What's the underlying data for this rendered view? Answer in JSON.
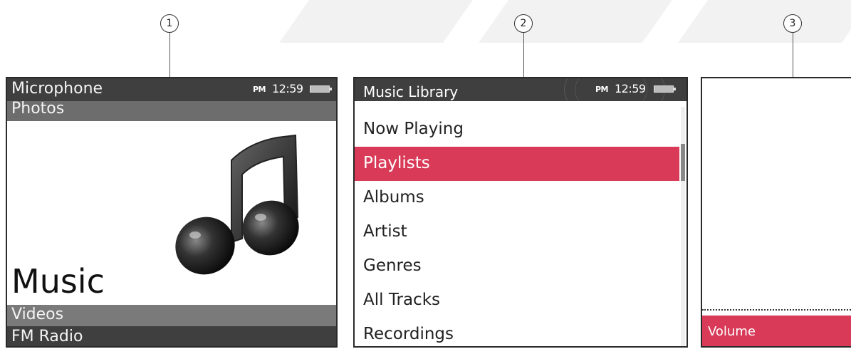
{
  "callouts": [
    "1",
    "2",
    "3"
  ],
  "status": {
    "ampm": "PM",
    "time": "12:59"
  },
  "screen1": {
    "items": [
      "Microphone",
      "Photos",
      "Music",
      "Videos",
      "FM Radio"
    ],
    "icon": "music-note-icon"
  },
  "screen2": {
    "title": "Music Library",
    "items": [
      "Now Playing",
      "Playlists",
      "Albums",
      "Artist",
      "Genres",
      "All Tracks",
      "Recordings"
    ],
    "selected_index": 1
  },
  "screen3": {
    "bar_label": "Volume"
  },
  "colors": {
    "accent": "#d83a58",
    "header": "#3f3f3f",
    "highlight": "#6d6d6d"
  }
}
